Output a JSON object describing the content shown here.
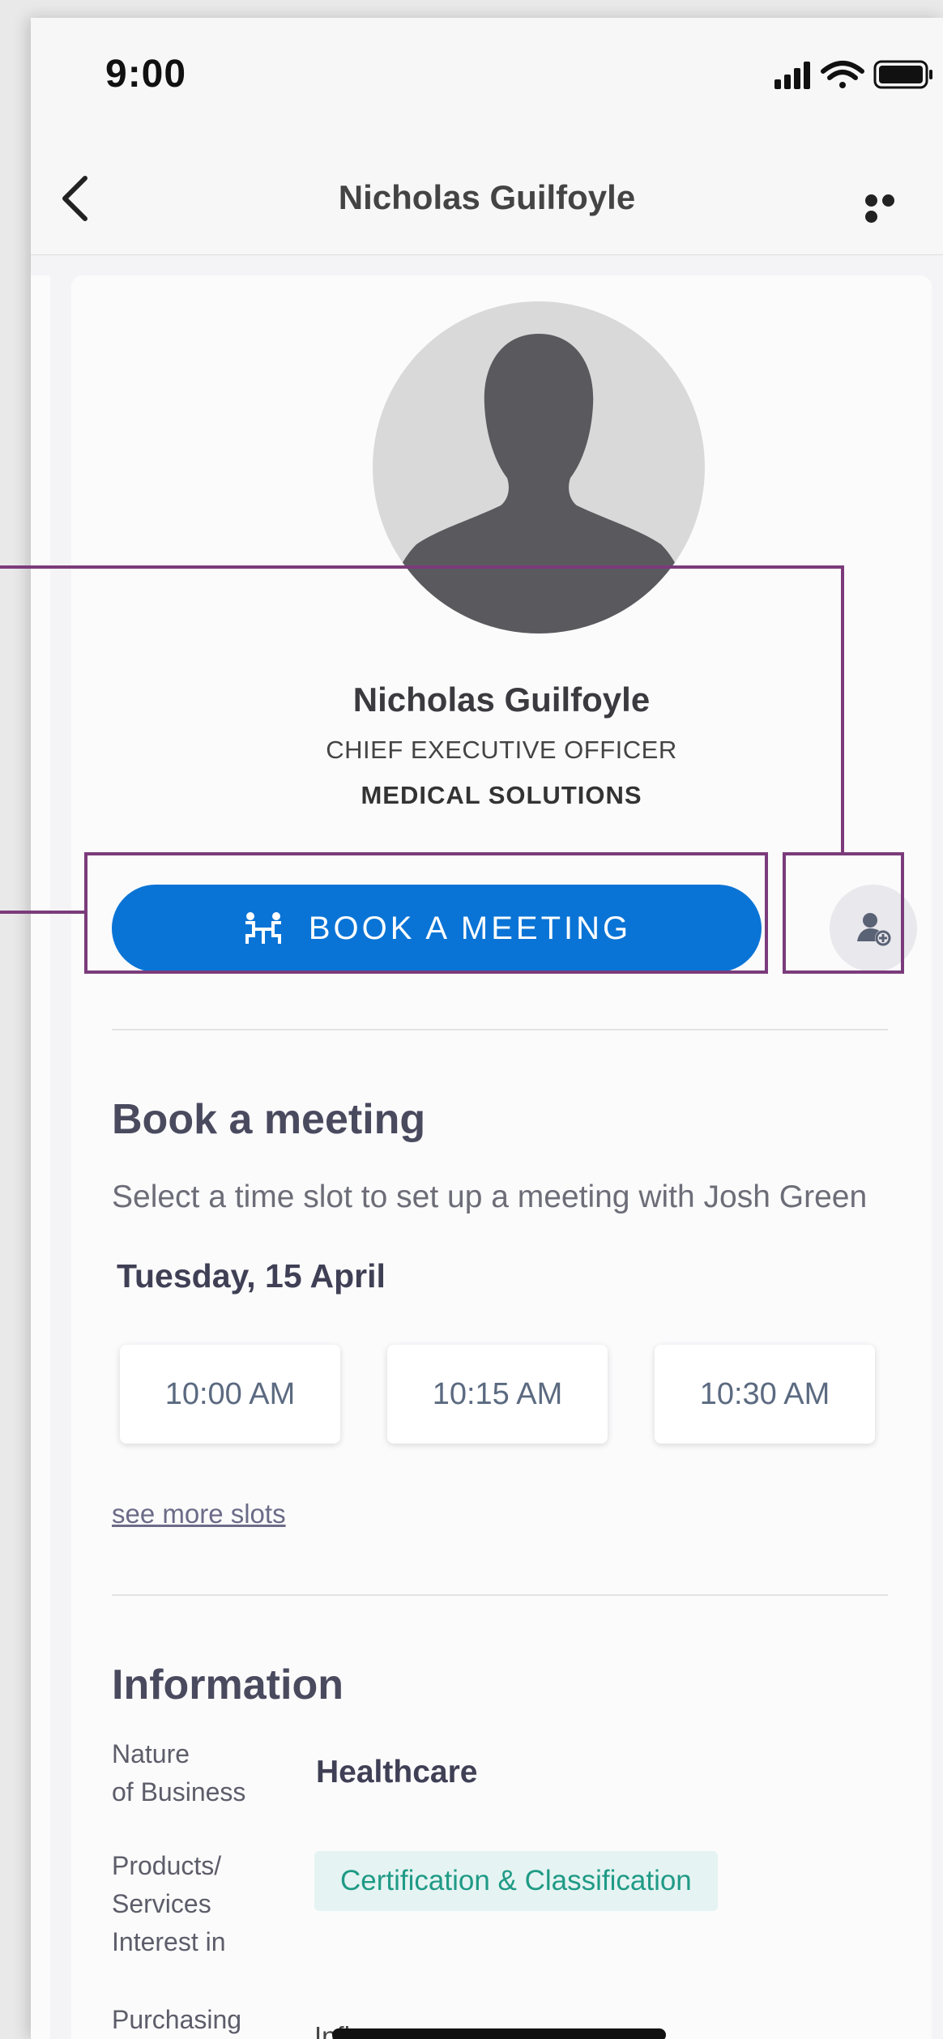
{
  "status_bar": {
    "time": "9:00"
  },
  "nav": {
    "title": "Nicholas Guilfoyle"
  },
  "profile": {
    "name": "Nicholas Guilfoyle",
    "role": "CHIEF EXECUTIVE OFFICER",
    "company": "MEDICAL SOLUTIONS",
    "book_button_label": "BOOK A MEETING"
  },
  "booking": {
    "title": "Book a meeting",
    "subtitle": "Select a time slot to set up a meeting with Josh Green",
    "date": "Tuesday, 15 April",
    "slots": [
      "10:00 AM",
      "10:15 AM",
      "10:30 AM"
    ],
    "more_link": "see more slots"
  },
  "information": {
    "title": "Information",
    "nature_label": "Nature\nof Business",
    "nature_value": "Healthcare",
    "products_label": "Products/\nServices\nInterest in",
    "products_tag": "Certification & Classification",
    "purchasing_label": "Purchasing\nResponsibility",
    "purchasing_value": "Influencer"
  },
  "colors": {
    "primary": "#0a74d6",
    "annotation": "#7b3b7b",
    "tag_bg": "#e5f4f2",
    "tag_text": "#1f9a86"
  }
}
